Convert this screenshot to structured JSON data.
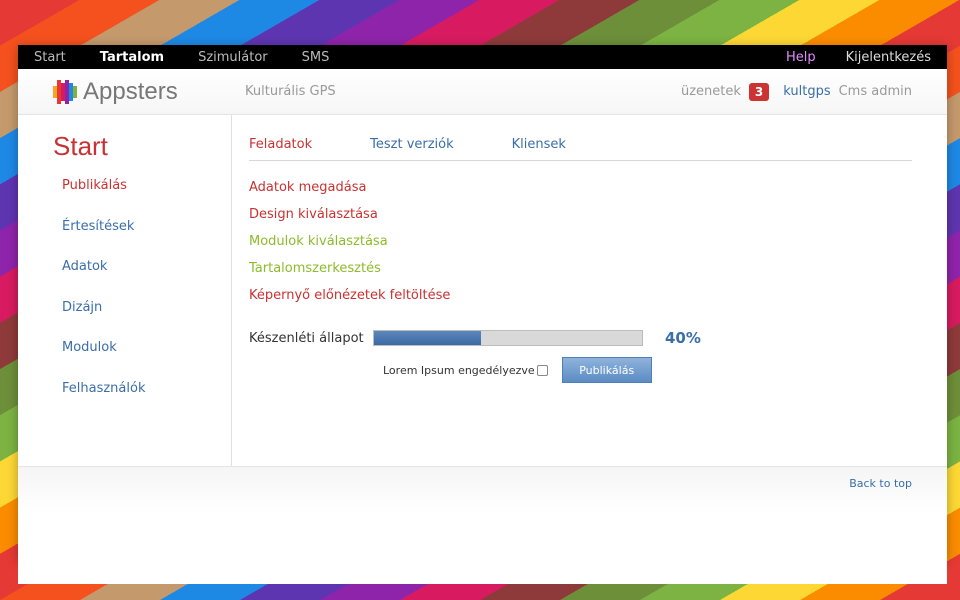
{
  "topnav": {
    "items": [
      {
        "label": "Start",
        "active": false
      },
      {
        "label": "Tartalom",
        "active": true
      },
      {
        "label": "Szimulátor",
        "active": false
      },
      {
        "label": "SMS",
        "active": false
      }
    ],
    "help": "Help",
    "logout": "Kijelentkezés"
  },
  "header": {
    "logo_text": "Appsters",
    "logo_colors": [
      "#f5a623",
      "#e53935",
      "#d81b60",
      "#8e24aa",
      "#1e88e5",
      "#7cb342"
    ],
    "site_name": "Kulturális GPS",
    "messages_label": "üzenetek",
    "messages_count": "3",
    "user_name": "kultgps",
    "user_role": "Cms admin"
  },
  "sidebar": {
    "title": "Start",
    "items": [
      {
        "label": "Publikálás",
        "active": true
      },
      {
        "label": "Értesítések",
        "active": false
      },
      {
        "label": "Adatok",
        "active": false
      },
      {
        "label": "Dizájn",
        "active": false
      },
      {
        "label": "Modulok",
        "active": false
      },
      {
        "label": "Felhasználók",
        "active": false
      }
    ]
  },
  "tabs": [
    {
      "label": "Feladatok",
      "active": true
    },
    {
      "label": "Teszt verziók",
      "active": false
    },
    {
      "label": "Kliensek",
      "active": false
    }
  ],
  "steps": [
    {
      "label": "Adatok megadása",
      "status": "todo"
    },
    {
      "label": "Design kiválasztása",
      "status": "todo"
    },
    {
      "label": "Modulok kiválasztása",
      "status": "done"
    },
    {
      "label": "Tartalomszerkesztés",
      "status": "done"
    },
    {
      "label": "Képernyő előnézetek feltöltése",
      "status": "todo"
    }
  ],
  "progress": {
    "label": "Készenléti állapot",
    "value": 0.4,
    "text": "40%"
  },
  "publish": {
    "checkbox_label": "Lorem Ipsum engedélyezve",
    "checked": false,
    "button_label": "Publikálás"
  },
  "footer": {
    "back_to_top": "Back to top"
  },
  "colors": {
    "accent_red": "#c83232",
    "link_blue": "#3a6ea8",
    "done_green": "#8dbb2a"
  }
}
